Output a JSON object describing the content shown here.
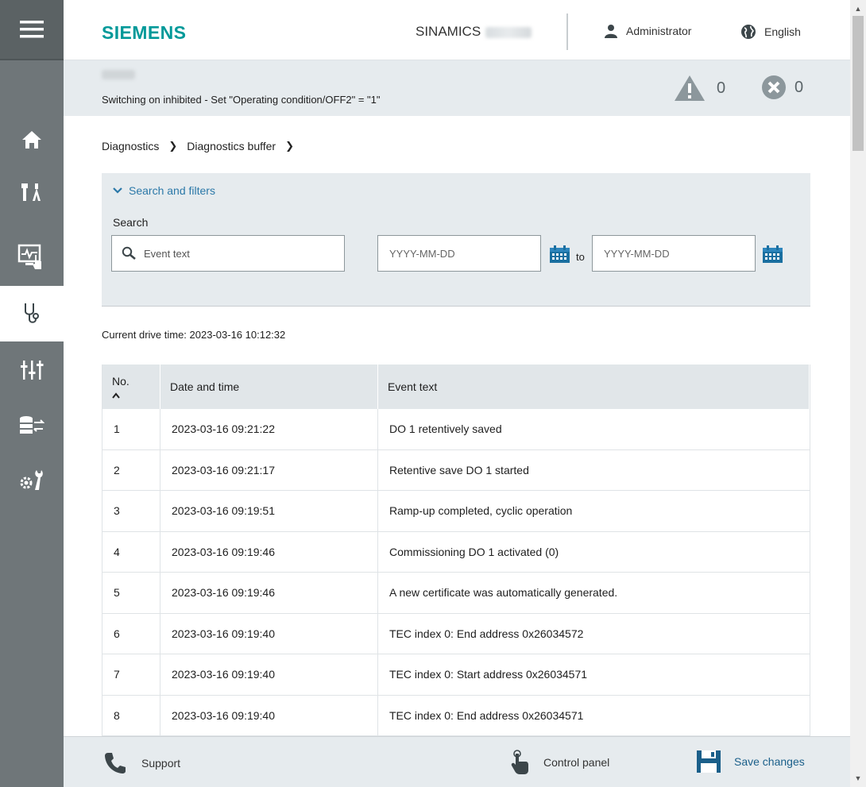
{
  "header": {
    "logo": "SIEMENS",
    "product": "SINAMICS",
    "user": "Administrator",
    "language": "English"
  },
  "status": {
    "message": "Switching on inhibited - Set \"Operating condition/OFF2\" = \"1\"",
    "warnings": "0",
    "errors": "0"
  },
  "breadcrumb": [
    "Diagnostics",
    "Diagnostics buffer"
  ],
  "filters": {
    "toggle_label": "Search and filters",
    "search_label": "Search",
    "search_placeholder": "Event text",
    "date_from_placeholder": "YYYY-MM-DD",
    "to_label": "to",
    "date_to_placeholder": "YYYY-MM-DD"
  },
  "drive_time": "Current drive time: 2023-03-16 10:12:32",
  "table": {
    "columns": [
      "No.",
      "Date and time",
      "Event text"
    ],
    "rows": [
      {
        "no": "1",
        "date": "2023-03-16 09:21:22",
        "event": "DO 1 retentively saved"
      },
      {
        "no": "2",
        "date": "2023-03-16 09:21:17",
        "event": "Retentive save DO 1 started"
      },
      {
        "no": "3",
        "date": "2023-03-16 09:19:51",
        "event": "Ramp-up completed, cyclic operation"
      },
      {
        "no": "4",
        "date": "2023-03-16 09:19:46",
        "event": "Commissioning DO 1 activated (0)"
      },
      {
        "no": "5",
        "date": "2023-03-16 09:19:46",
        "event": "A new certificate was automatically generated."
      },
      {
        "no": "6",
        "date": "2023-03-16 09:19:40",
        "event": "TEC index 0: End address 0x26034572"
      },
      {
        "no": "7",
        "date": "2023-03-16 09:19:40",
        "event": "TEC index 0: Start address 0x26034571"
      },
      {
        "no": "8",
        "date": "2023-03-16 09:19:40",
        "event": "TEC index 0: End address 0x26034571"
      }
    ]
  },
  "footer": {
    "support": "Support",
    "control_panel": "Control panel",
    "save_changes": "Save changes"
  },
  "colors": {
    "brand": "#009999",
    "sidebar": "#6f7679",
    "panel": "#e6ebee",
    "link": "#2b78a8",
    "save": "#1a5f8a"
  }
}
